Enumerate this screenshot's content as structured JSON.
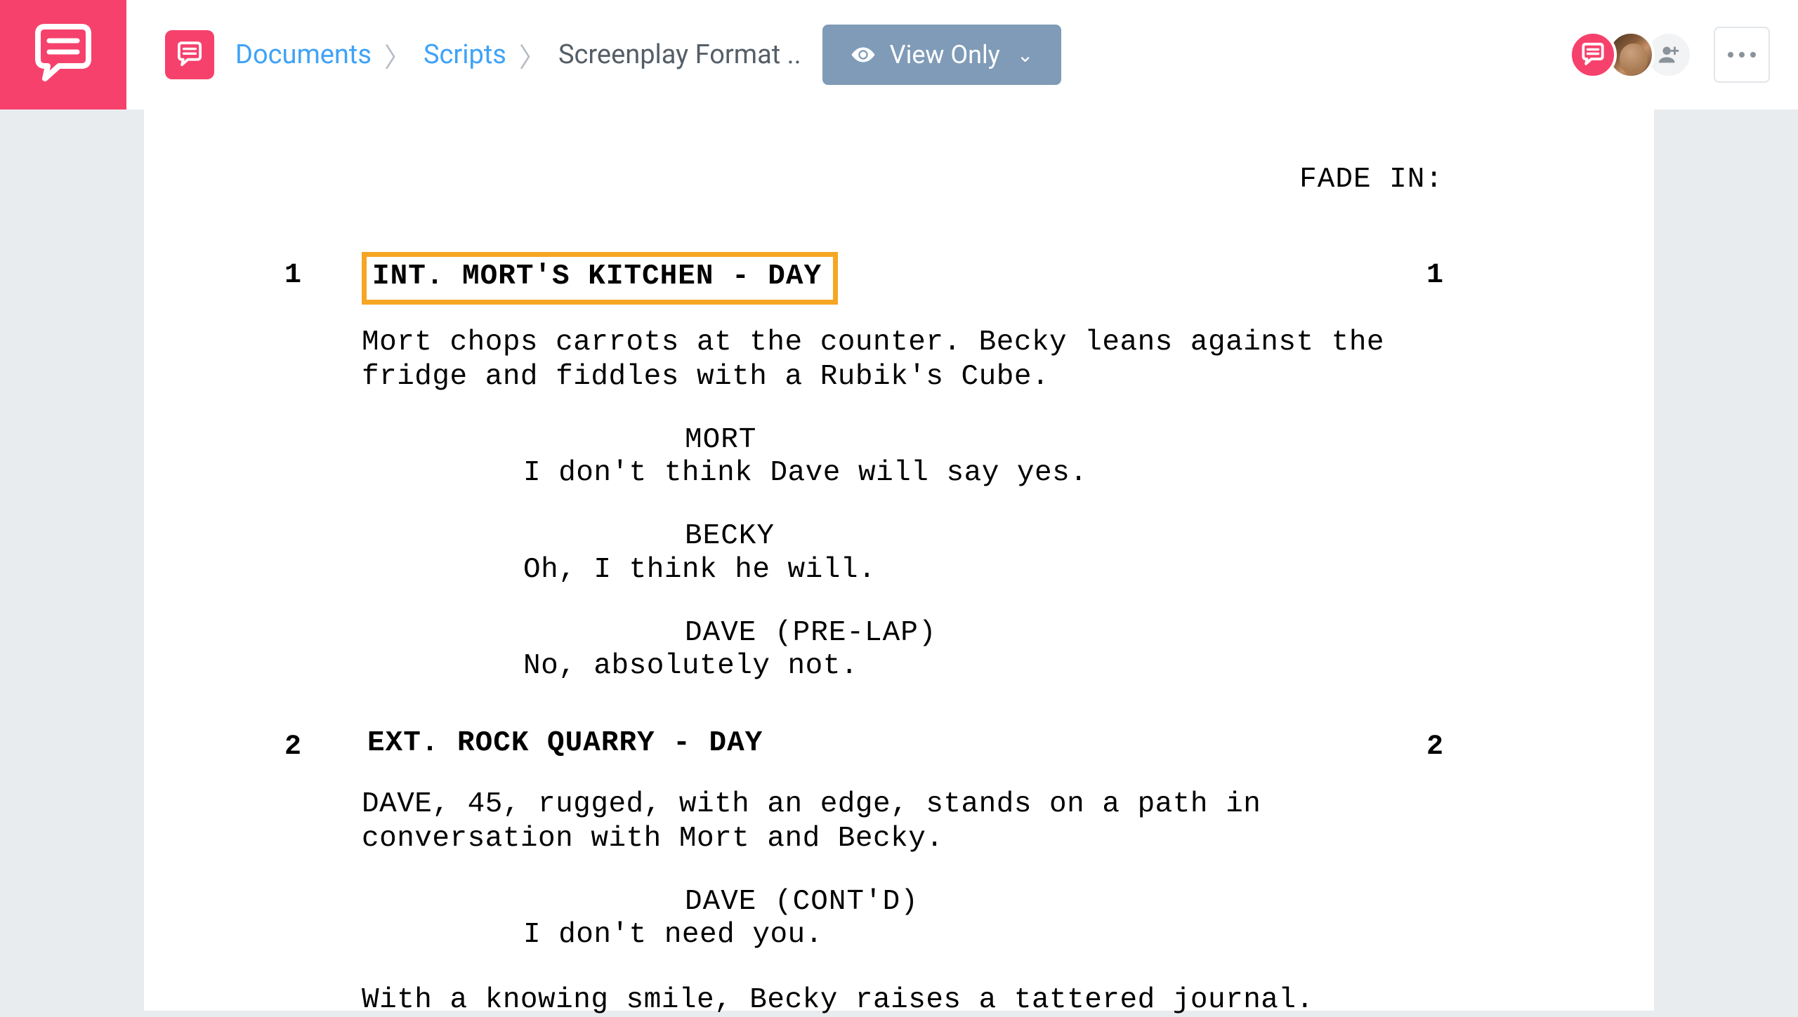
{
  "colors": {
    "accent": "#f6416c",
    "link": "#3fa2f7",
    "toolbarBtn": "#7f9bb7",
    "highlight": "#f5a623"
  },
  "icons": {
    "logo": "chat-bubble-icon",
    "smallLogo": "chat-bubble-icon",
    "eye": "eye-icon",
    "chevron": "chevron-down-icon",
    "avatarLogo": "chat-bubble-icon",
    "addUser": "add-user-icon",
    "more": "more-horizontal-icon"
  },
  "breadcrumbs": {
    "items": [
      {
        "label": "Documents",
        "link": true
      },
      {
        "label": "Scripts",
        "link": true
      },
      {
        "label": "Screenplay Format ..",
        "link": false
      }
    ]
  },
  "viewButton": {
    "label": "View Only"
  },
  "script": {
    "fade_in": "FADE IN:",
    "scenes": [
      {
        "number_left": "1",
        "number_right": "1",
        "heading": "INT. MORT'S KITCHEN - DAY",
        "highlighted": true,
        "blocks": [
          {
            "type": "action",
            "text": "Mort chops carrots at the counter. Becky leans against the fridge and fiddles with a Rubik's Cube."
          },
          {
            "type": "dialogue",
            "character": "MORT",
            "text": "I don't think Dave will say yes."
          },
          {
            "type": "dialogue",
            "character": "BECKY",
            "text": "Oh, I think he will."
          },
          {
            "type": "dialogue",
            "character": "DAVE (PRE-LAP)",
            "text": "No, absolutely not."
          }
        ]
      },
      {
        "number_left": "2",
        "number_right": "2",
        "heading": "EXT. ROCK QUARRY - DAY",
        "highlighted": false,
        "blocks": [
          {
            "type": "action",
            "text": "DAVE, 45, rugged, with an edge, stands on a path in conversation with Mort and Becky."
          },
          {
            "type": "dialogue",
            "character": "DAVE (CONT'D)",
            "text": "I don't need you."
          },
          {
            "type": "action",
            "text": "With a knowing smile, Becky raises a tattered journal."
          }
        ]
      }
    ]
  }
}
